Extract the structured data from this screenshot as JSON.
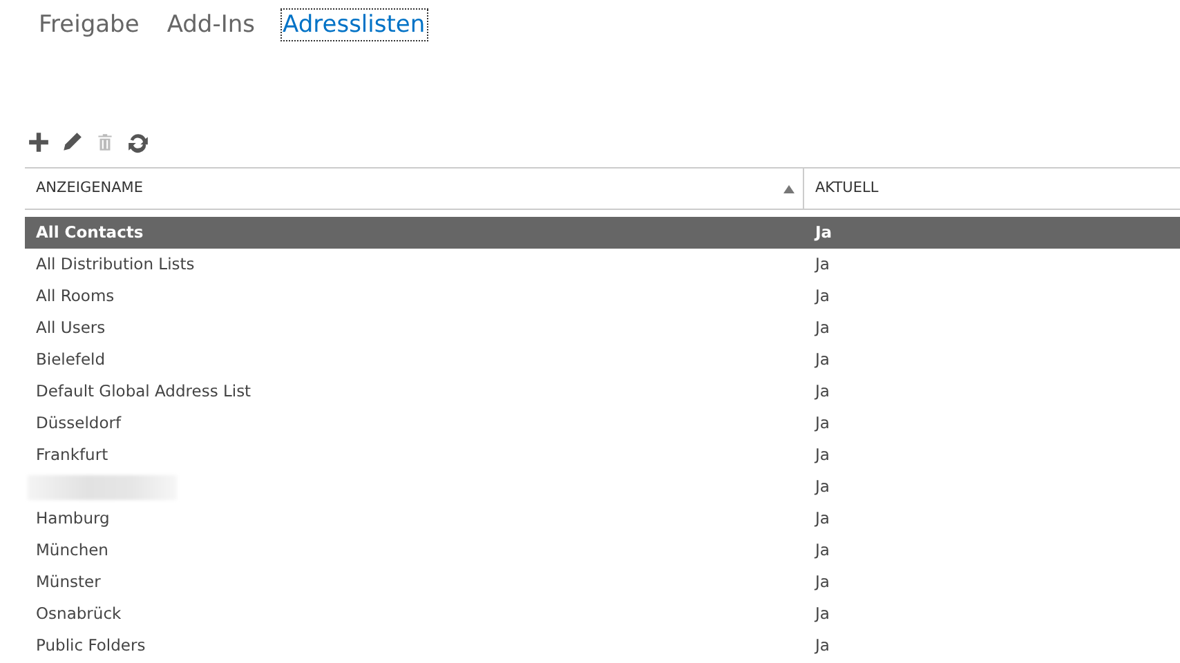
{
  "tabs": [
    {
      "label": "Freigabe",
      "selected": false
    },
    {
      "label": "Add-Ins",
      "selected": false
    },
    {
      "label": "Adresslisten",
      "selected": true
    }
  ],
  "toolbar": [
    {
      "kind": "add",
      "disabled": false
    },
    {
      "kind": "edit",
      "disabled": false
    },
    {
      "kind": "delete",
      "disabled": true
    },
    {
      "kind": "refresh",
      "disabled": false
    }
  ],
  "table": {
    "columns": [
      {
        "label": "ANZEIGENAME",
        "sorted_ascending": true
      },
      {
        "label": "AKTUELL"
      }
    ],
    "rows": [
      {
        "name": "All Contacts",
        "current": "Ja",
        "selected": true
      },
      {
        "name": "All Distribution Lists",
        "current": "Ja",
        "selected": false
      },
      {
        "name": "All Rooms",
        "current": "Ja",
        "selected": false
      },
      {
        "name": "All Users",
        "current": "Ja",
        "selected": false
      },
      {
        "name": "Bielefeld",
        "current": "Ja",
        "selected": false
      },
      {
        "name": "Default Global Address List",
        "current": "Ja",
        "selected": false
      },
      {
        "name": "Düsseldorf",
        "current": "Ja",
        "selected": false
      },
      {
        "name": "Frankfurt",
        "current": "Ja",
        "selected": false
      },
      {
        "kind": "redacted",
        "current": "Ja",
        "selected": false
      },
      {
        "name": "Hamburg",
        "current": "Ja",
        "selected": false
      },
      {
        "name": "München",
        "current": "Ja",
        "selected": false
      },
      {
        "name": "Münster",
        "current": "Ja",
        "selected": false
      },
      {
        "name": "Osnabrück",
        "current": "Ja",
        "selected": false
      },
      {
        "name": "Public Folders",
        "current": "Ja",
        "selected": false
      }
    ]
  }
}
